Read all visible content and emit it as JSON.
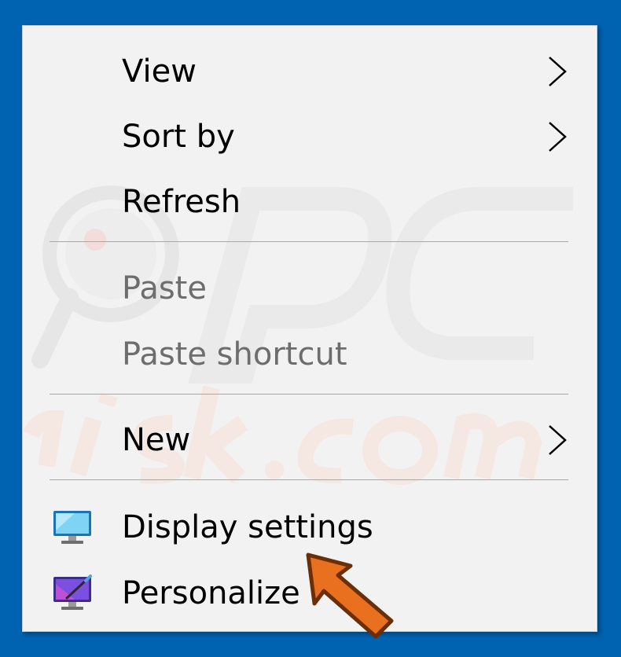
{
  "menu": {
    "items": [
      {
        "label": "View",
        "disabled": false,
        "submenu": true
      },
      {
        "label": "Sort by",
        "disabled": false,
        "submenu": true
      },
      {
        "label": "Refresh",
        "disabled": false,
        "submenu": false
      },
      {
        "label": "Paste",
        "disabled": true,
        "submenu": false
      },
      {
        "label": "Paste shortcut",
        "disabled": true,
        "submenu": false
      },
      {
        "label": "New",
        "disabled": false,
        "submenu": true
      },
      {
        "label": "Display settings",
        "disabled": false,
        "submenu": false,
        "icon": "monitor-icon"
      },
      {
        "label": "Personalize",
        "disabled": false,
        "submenu": false,
        "icon": "personalize-icon"
      }
    ]
  },
  "colors": {
    "desktop": "#0063B1",
    "menu_bg": "#F2F2F2",
    "disabled_text": "#6D6D6D",
    "arrow": "#E8701E"
  },
  "annotation": {
    "icon": "pointer-arrow-icon"
  }
}
